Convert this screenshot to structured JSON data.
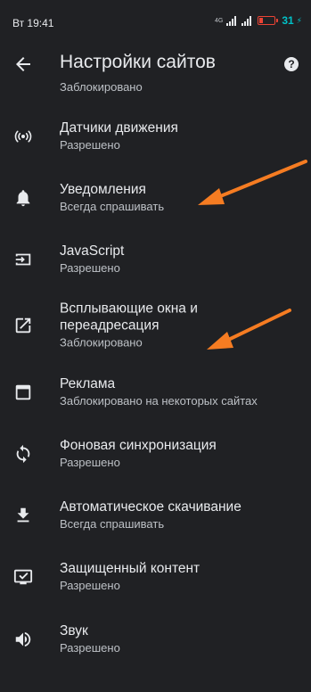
{
  "status": {
    "time": "Вт 19:41",
    "network": "4G",
    "battery": "31"
  },
  "header": {
    "title": "Настройки сайтов",
    "help_icon": "?"
  },
  "partial_item": {
    "sub": "Заблокировано"
  },
  "items": [
    {
      "icon": "motion-sensors-icon",
      "label": "Датчики движения",
      "sub": "Разрешено"
    },
    {
      "icon": "bell-icon",
      "label": "Уведомления",
      "sub": "Всегда спрашивать"
    },
    {
      "icon": "javascript-icon",
      "label": "JavaScript",
      "sub": "Разрешено"
    },
    {
      "icon": "open-in-new-icon",
      "label": "Всплывающие окна и переадресация",
      "sub": "Заблокировано"
    },
    {
      "icon": "ads-window-icon",
      "label": "Реклама",
      "sub": "Заблокировано на некоторых сайтах"
    },
    {
      "icon": "sync-icon",
      "label": "Фоновая синхронизация",
      "sub": "Разрешено"
    },
    {
      "icon": "download-icon",
      "label": "Автоматическое скачивание",
      "sub": "Всегда спрашивать"
    },
    {
      "icon": "protected-content-icon",
      "label": "Защищенный контент",
      "sub": "Разрешено"
    },
    {
      "icon": "volume-icon",
      "label": "Звук",
      "sub": "Разрешено"
    }
  ],
  "colors": {
    "background": "#202124",
    "text": "#e8eaed",
    "subtext": "#bdc1c6",
    "annotation_arrow": "#f57c22"
  }
}
